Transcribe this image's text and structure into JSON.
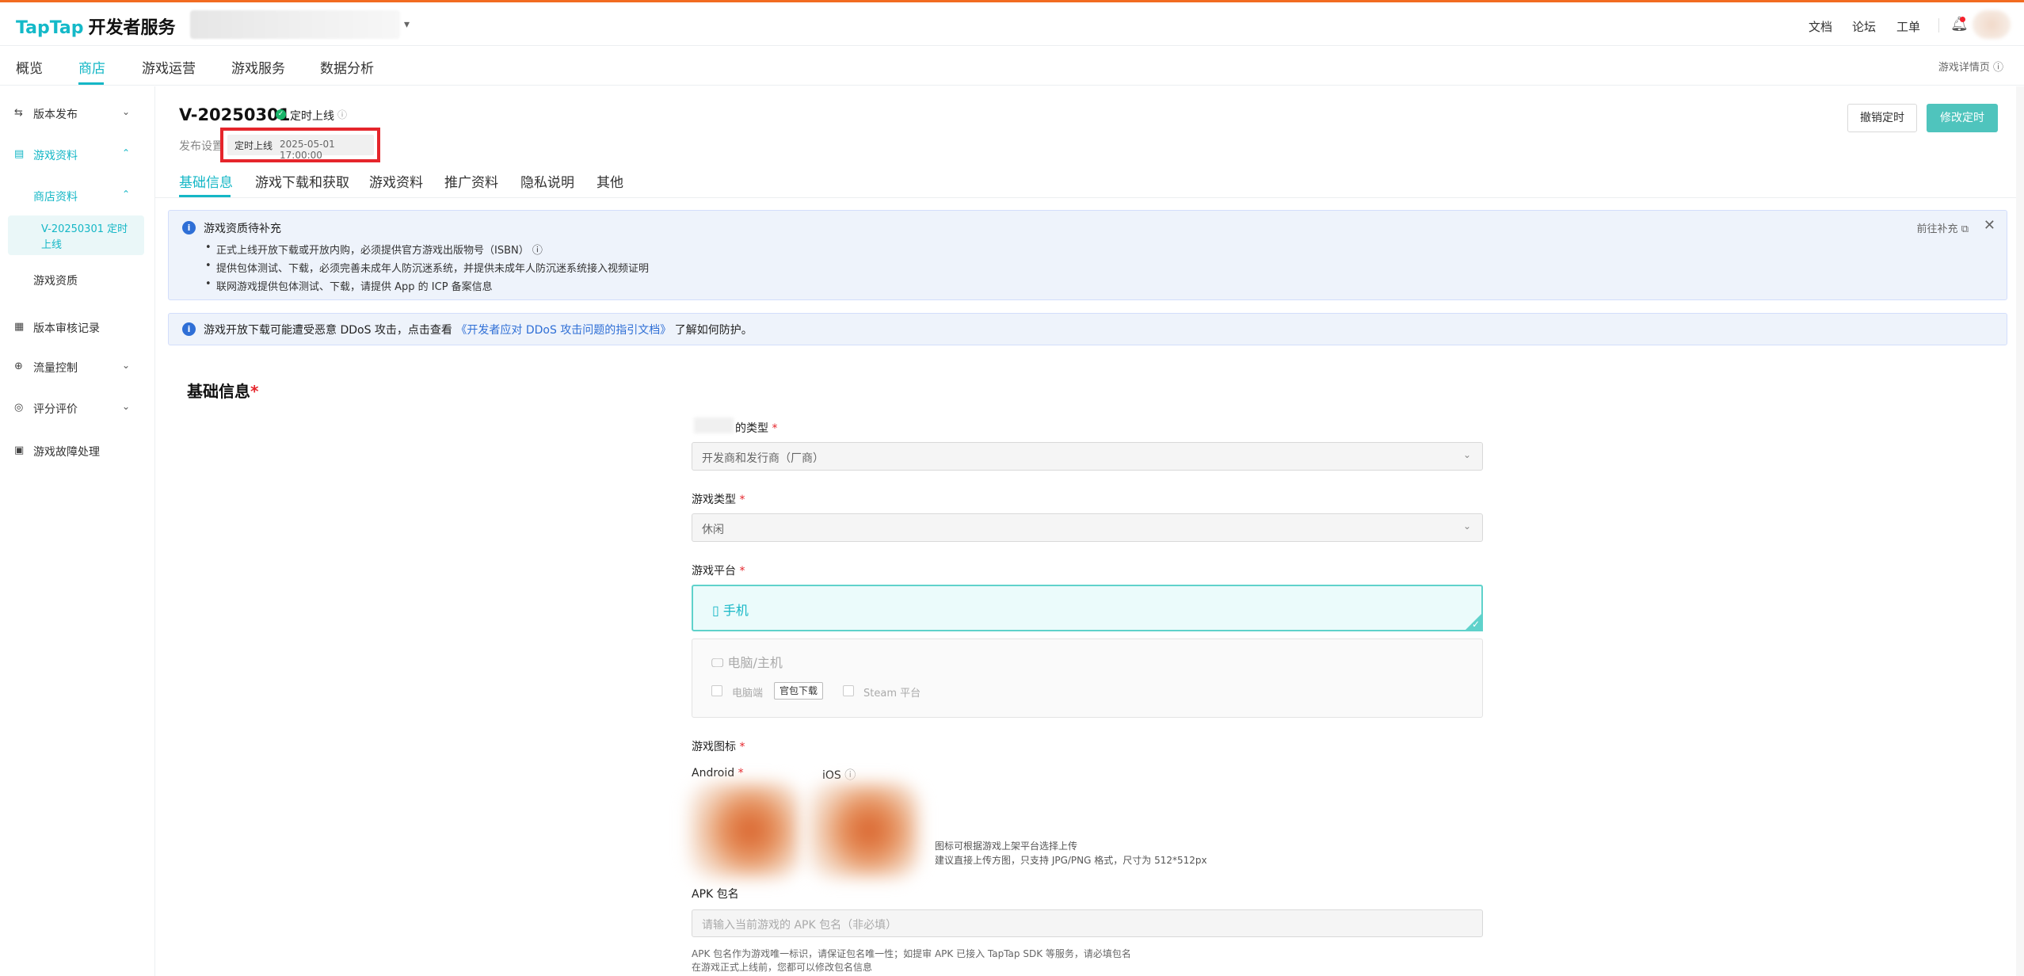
{
  "header": {
    "logo_brand": "TapTap",
    "logo_suffix": "开发者服务",
    "links": [
      "文档",
      "论坛",
      "工单"
    ]
  },
  "nav": {
    "items": [
      "概览",
      "商店",
      "游戏运营",
      "游戏服务",
      "数据分析"
    ],
    "active": "商店",
    "right_link": "游戏详情页"
  },
  "sidebar": {
    "items": [
      {
        "label": "版本发布",
        "icon": "release-icon"
      },
      {
        "label": "游戏资料",
        "icon": "doc-icon"
      },
      {
        "label": "商店资料"
      },
      {
        "label": "V-20250301 定时上线"
      },
      {
        "label": "游戏资质"
      },
      {
        "label": "版本审核记录",
        "icon": "clipboard-icon"
      },
      {
        "label": "流量控制",
        "icon": "flow-icon"
      },
      {
        "label": "评分评价",
        "icon": "rating-icon"
      },
      {
        "label": "游戏故障处理",
        "icon": "fault-icon"
      }
    ]
  },
  "page": {
    "version": "V-20250301",
    "status": "定时上线",
    "publish_label": "发布设置",
    "publish_tag": "定时上线",
    "publish_time": "2025-05-01 17:00:00",
    "btn_cancel": "撤销定时",
    "btn_modify": "修改定时",
    "tabs": [
      "基础信息",
      "游戏下载和获取",
      "游戏资料",
      "推广资料",
      "隐私说明",
      "其他"
    ],
    "active_tab": "基础信息"
  },
  "alert1": {
    "title": "游戏资质待补充",
    "items": [
      "正式上线开放下载或开放内购，必须提供官方游戏出版物号（ISBN）",
      "提供包体测试、下载，必须完善未成年人防沉迷系统，并提供未成年人防沉迷系统接入视频证明",
      "联网游戏提供包体测试、下载，请提供 App 的 ICP 备案信息"
    ],
    "go_link": "前往补充"
  },
  "alert2": {
    "pre": "游戏开放下载可能遭受恶意 DDoS 攻击，点击查看",
    "link": "《开发者应对 DDoS 攻击问题的指引文档》",
    "post": "了解如何防护。"
  },
  "form": {
    "section": "基础信息",
    "type_label": "的类型",
    "type_value": "开发商和发行商（厂商）",
    "genre_label": "游戏类型",
    "genre_value": "休闲",
    "platform_label": "游戏平台",
    "platform_phone": "手机",
    "platform_pc": "电脑/主机",
    "pc_option": "电脑端",
    "pc_tag": "官包下载",
    "steam_option": "Steam 平台",
    "icon_label": "游戏图标",
    "android": "Android",
    "ios": "iOS",
    "icon_note1": "图标可根据游戏上架平台选择上传",
    "icon_note2": "建议直接上传方图，只支持 JPG/PNG 格式，尺寸为 512*512px",
    "apk_label": "APK 包名",
    "apk_placeholder": "请输入当前游戏的 APK 包名（非必填）",
    "apk_help1": "APK 包名作为游戏唯一标识，请保证包名唯一性；如提审 APK 已接入 TapTap SDK 等服务，请必填包名",
    "apk_help2": "在游戏正式上线前，您都可以修改包名信息"
  },
  "colors": {
    "accent": "#15b7c6",
    "primary_button": "#4fc4bd",
    "highlight": "#e5252b",
    "top_line": "#f26b21"
  }
}
